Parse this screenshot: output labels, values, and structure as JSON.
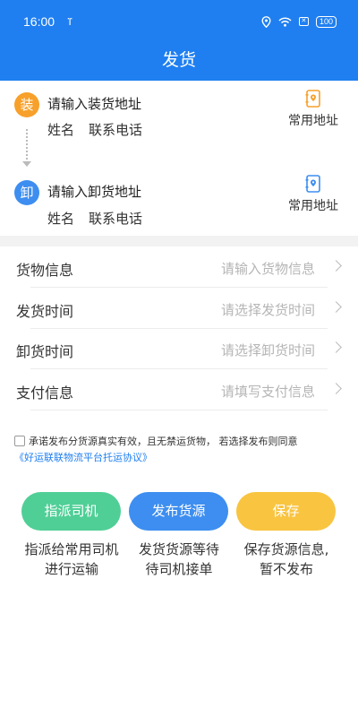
{
  "status_bar": {
    "time": "16:00",
    "usb": "ⴶ",
    "sim": "✕",
    "battery": "100"
  },
  "header": {
    "title": "发货"
  },
  "load": {
    "badge": "装",
    "badge_color": "#f7a02b",
    "address_placeholder": "请输入装货地址",
    "name_label": "姓名",
    "phone_label": "联系电话",
    "common_label": "常用地址",
    "icon": "address-book-icon"
  },
  "unload": {
    "badge": "卸",
    "badge_color": "#3d8ef0",
    "address_placeholder": "请输入卸货地址",
    "name_label": "姓名",
    "phone_label": "联系电话",
    "common_label": "常用地址",
    "icon": "address-book-icon"
  },
  "form": {
    "rows": [
      {
        "label": "货物信息",
        "placeholder": "请输入货物信息"
      },
      {
        "label": "发货时间",
        "placeholder": "请选择发货时间"
      },
      {
        "label": "卸货时间",
        "placeholder": "请选择卸货时间"
      },
      {
        "label": "支付信息",
        "placeholder": "请填写支付信息"
      }
    ]
  },
  "agreement": {
    "text": "承诺发布分货源真实有效，且无禁运货物，  若选择发布则同意",
    "link": "《好运联联物流平台托运协议》"
  },
  "actions": [
    {
      "label": "指派司机",
      "color": "#4fcf96",
      "desc_line1": "指派给常用司机",
      "desc_line2": "进行运输"
    },
    {
      "label": "发布货源",
      "color": "#3d8ef0",
      "desc_line1": "发货货源等待",
      "desc_line2": "待司机接单"
    },
    {
      "label": "保存",
      "color": "#f9c440",
      "desc_line1": "保存货源信息,",
      "desc_line2": "暂不发布"
    }
  ],
  "colors": {
    "primary": "#1f7ff0",
    "placeholder": "#b5b5b5",
    "link": "#1f7ff0"
  }
}
